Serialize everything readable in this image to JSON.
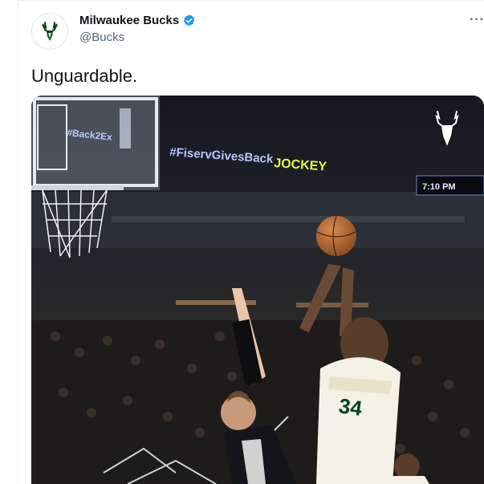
{
  "author": {
    "display_name": "Milwaukee Bucks",
    "handle": "@Bucks",
    "avatar_icon": "bucks-deer-logo-icon",
    "verified_icon": "verified-badge-icon"
  },
  "tweet": {
    "text": "Unguardable.",
    "more_icon": "more-options-icon"
  },
  "media": {
    "type": "video-frame",
    "arena_ribbon_text": "#FiservGivesBack",
    "arena_ribbon_brand": "JOCKEY",
    "backboard_ribbon_text": "#Back2Ex",
    "scoreboard_text": "7:10 PM",
    "jersey_number": "34",
    "watermark_icon": "bucks-watermark-icon"
  },
  "colors": {
    "verified_blue": "#1d9bf0",
    "bucks_green": "#00471b",
    "ribbon_text": "#b9c4ff",
    "ribbon_brand": "#e4f24a"
  }
}
